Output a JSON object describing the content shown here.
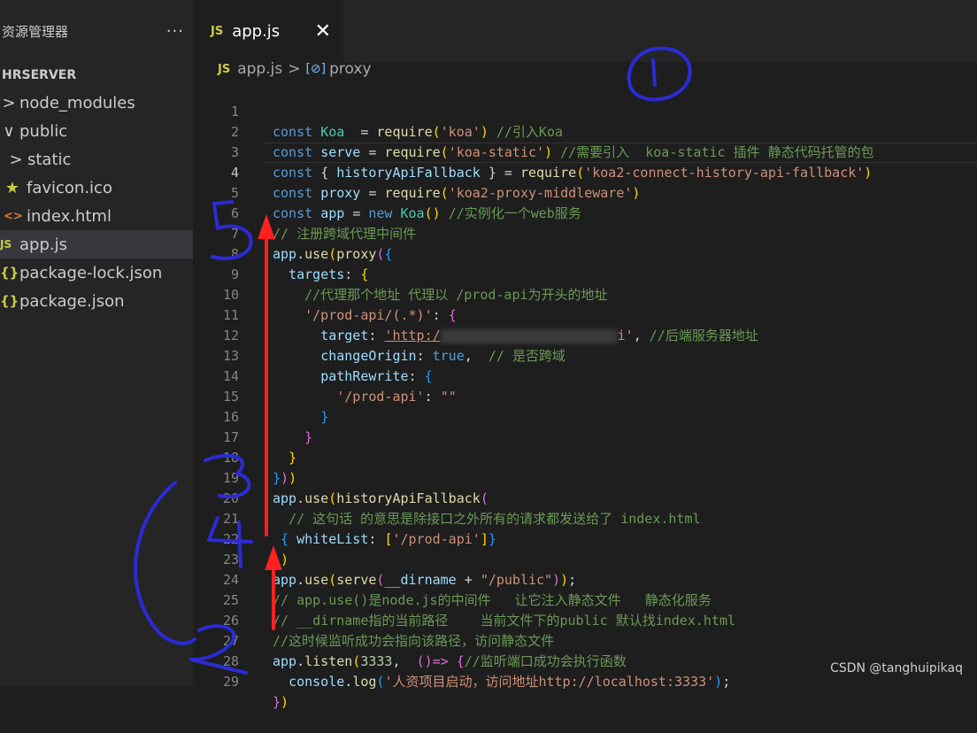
{
  "sidebar": {
    "title": "资源管理器",
    "more": "···",
    "section": "HRSERVER",
    "items": [
      {
        "twisty": ">",
        "icon": "",
        "label": "node_modules"
      },
      {
        "twisty": "∨",
        "icon": "",
        "label": "public"
      },
      {
        "twisty": ">",
        "icon": "",
        "label": "static"
      },
      {
        "twisty": "",
        "icon": "★",
        "label": "favicon.ico"
      },
      {
        "twisty": "",
        "icon": "<>",
        "label": "index.html"
      },
      {
        "twisty": "",
        "icon": "JS",
        "label": "app.js"
      },
      {
        "twisty": "",
        "icon": "{}",
        "label": "package-lock.json"
      },
      {
        "twisty": "",
        "icon": "{}",
        "label": "package.json"
      }
    ]
  },
  "tab": {
    "badge": "JS",
    "name": "app.js",
    "close": "✕"
  },
  "breadcrumb": {
    "badge": "JS",
    "file": "app.js",
    "sep": ">",
    "symbol": "[⊘]",
    "symbol_name": "proxy"
  },
  "code": {
    "line_numbers": [
      "1",
      "2",
      "3",
      "4",
      "5",
      "6",
      "7",
      "8",
      "9",
      "10",
      "11",
      "12",
      "13",
      "14",
      "15",
      "16",
      "17",
      "18",
      "19",
      "20",
      "21",
      "22",
      "23",
      "24",
      "25",
      "26",
      "27",
      "28",
      "29"
    ],
    "l1": [
      "const",
      "Koa",
      "=",
      "require",
      "(",
      "'koa'",
      ")",
      "//引入Koa"
    ],
    "l2": [
      "const",
      "serve",
      "=",
      "require",
      "(",
      "'koa-static'",
      ")",
      "//需要引入  koa-static 插件 静态代码托管的包"
    ],
    "l3": [
      "const",
      "{ ",
      "historyApiFallback",
      " }",
      "=",
      "require",
      "(",
      "'koa2-connect-history-api-fallback'",
      ")"
    ],
    "l4": [
      "const",
      "proxy",
      "=",
      "require",
      "(",
      "'koa2-proxy-middleware'",
      ")"
    ],
    "l5": [
      "const",
      "app",
      "=",
      "new",
      "Koa",
      "()",
      "//实例化一个web服务"
    ],
    "l6": [
      "// 注册跨域代理中间件"
    ],
    "l7": [
      "app",
      ".",
      "use",
      "(",
      "proxy",
      "(",
      "{"
    ],
    "l8": [
      "targets",
      ": ",
      "{"
    ],
    "l9": [
      "//代理那个地址 代理以 /prod-api为开头的地址"
    ],
    "l10": [
      "'/prod-api/(.*)'",
      ": ",
      "{"
    ],
    "l11": [
      "target",
      ": ",
      "'http:/",
      "i'",
      ", ",
      "//后端服务器地址"
    ],
    "l12": [
      "changeOrigin",
      ": ",
      "true",
      ",  ",
      "// 是否跨域"
    ],
    "l13": [
      "pathRewrite",
      ": ",
      "{"
    ],
    "l14": [
      "'/prod-api'",
      ": ",
      "\"\""
    ],
    "l15": [
      "}"
    ],
    "l16": [
      "}"
    ],
    "l17": [
      "}"
    ],
    "l18": [
      "}",
      ")",
      ")"
    ],
    "l19": [
      "app",
      ".",
      "use",
      "(",
      "historyApiFallback",
      "("
    ],
    "l20": [
      "// 这句话 的意思是除接口之外所有的请求都发送给了 index.html"
    ],
    "l21": [
      "{ ",
      "whiteList",
      ": ",
      "[",
      "'/prod-api'",
      "]",
      "}"
    ],
    "l22": [
      ")",
      ")"
    ],
    "l23": [
      "app",
      ".",
      "use",
      "(",
      "serve",
      "(",
      "__dirname",
      " + ",
      "\"/public\"",
      ")",
      ")",
      ";"
    ],
    "l24": [
      "// app.use()是node.js的中间件   让它注入静态文件   静态化服务"
    ],
    "l25": [
      "// __dirname指的当前路径    当前文件下的public 默认找index.html"
    ],
    "l26": [
      "//这时候监听成功会指向该路径，访问静态文件"
    ],
    "l27": [
      "app",
      ".",
      "listen",
      "(",
      "3333",
      ",  ",
      "()=> ",
      "{",
      "//监听端口成功会执行函数"
    ],
    "l28": [
      "console",
      ".",
      "log",
      "(",
      "'人资项目启动，访问地址http://localhost:3333'",
      ")",
      ";"
    ],
    "l29": [
      "}",
      ")"
    ]
  },
  "annotations": {
    "icon": "handwritten-marks",
    "ink_color": "#2b2bd6",
    "arrow_color": "#ff2020"
  },
  "watermark": "CSDN @tanghuipikaq"
}
